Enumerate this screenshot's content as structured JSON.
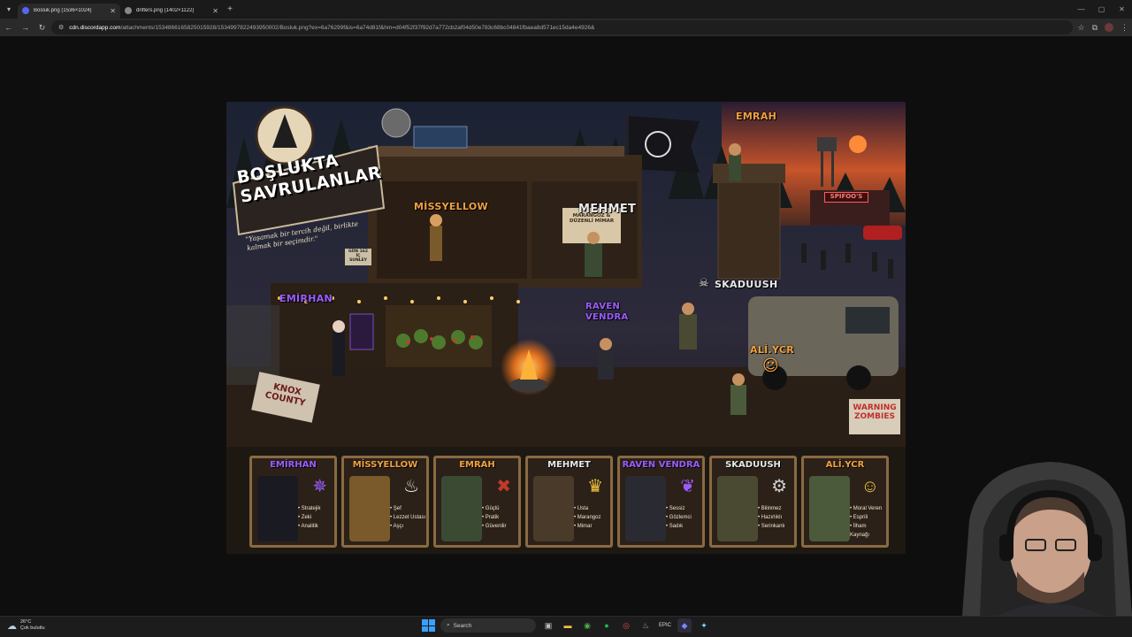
{
  "browser": {
    "tabs": [
      {
        "title": "Bosluk.png (1536×1024)",
        "active": true
      },
      {
        "title": "drifters.png (1402×1122)",
        "active": false
      }
    ],
    "new_tab": "+",
    "url_host": "cdn.discordapp.com",
    "url_path": "/attachments/1534866165825015928/1534997822493950002/Bosluk.png?ex=6a76299f&is=6a74d81f&hm=d04f52f37f92d7a772cb2af04d50e783c68bc04841fbaea8d571ec15da4e4926&"
  },
  "poster": {
    "title_line1": "BOŞLUKTA",
    "title_line2": "SAVRULANLAR",
    "tagline": "\"Yaşamak bir tercih değil, birlikte kalmak bir seçimdir.\"",
    "scene_labels": {
      "emrah": "EMRAH",
      "missyellow": "MİSSYELLOW",
      "mehmet": "MEHMET",
      "emirhan": "EMİRHAN",
      "raven": "RAVEN VENDRA",
      "skaduush": "SKADUUSH",
      "aliycr": "ALİ.YCR"
    },
    "signs": {
      "spifoos": "SPIFOO'S",
      "knox": "KNOX COUNTY",
      "warning": "WARNING ZOMBIES",
      "marangoz": "MARANGOZ & DÜZENLİ MİMAR",
      "gun": "GÜN 162 İÇ SUNLEY"
    },
    "cards": [
      {
        "name": "EMİRHAN",
        "color": "#9b5cff",
        "icon": "compass-star-icon",
        "glyph": "✵",
        "traits": [
          "Stratejik",
          "Zeki",
          "Analitik"
        ]
      },
      {
        "name": "MİSSYELLOW",
        "color": "#f0a040",
        "icon": "chef-hat-icon",
        "glyph": "♨",
        "traits": [
          "Şef",
          "Lezzet Ustası",
          "Aşçı"
        ]
      },
      {
        "name": "EMRAH",
        "color": "#f0a040",
        "icon": "crossed-axes-icon",
        "glyph": "✖",
        "traits": [
          "Güçlü",
          "Pratik",
          "Güvenilir"
        ]
      },
      {
        "name": "MEHMET",
        "color": "#e8e8e8",
        "icon": "crown-icon",
        "glyph": "♛",
        "traits": [
          "Usta",
          "Marangoz",
          "Mimar"
        ]
      },
      {
        "name": "RAVEN VENDRA",
        "color": "#9b5cff",
        "icon": "raven-icon",
        "glyph": "❦",
        "traits": [
          "Sessiz",
          "Gözlemci",
          "Sadık"
        ]
      },
      {
        "name": "SKADUUSH",
        "color": "#e8e8e8",
        "icon": "gear-icon",
        "glyph": "⚙",
        "traits": [
          "Bilinmez",
          "Hazırlıklı",
          "Serinkanlı"
        ]
      },
      {
        "name": "ALİ.YCR",
        "color": "#f0a040",
        "icon": "smiley-icon",
        "glyph": "☺",
        "traits": [
          "Moral Veren",
          "Esprili",
          "İlham Kaynağı"
        ]
      }
    ]
  },
  "taskbar": {
    "weather_temp": "26°C",
    "weather_desc": "Çok bulutlu",
    "search_label": "Search"
  }
}
